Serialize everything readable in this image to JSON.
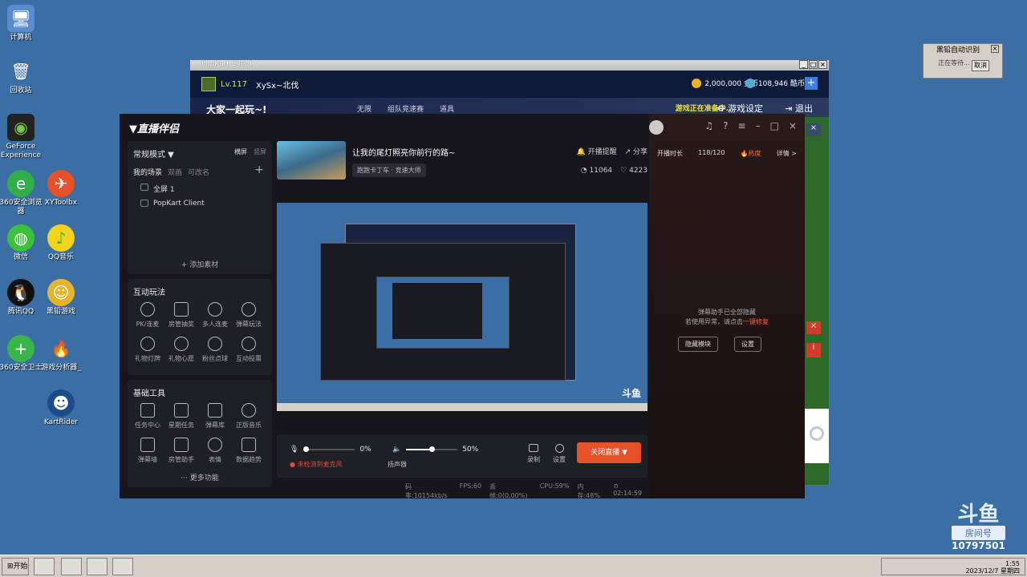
{
  "desktop": {
    "icons": [
      "计算机",
      "回收站",
      "GeForce Experience",
      "360安全浏览器",
      "360安全卫士",
      "微信",
      "QQ音乐",
      "腾讯QQ",
      "黑铅游戏",
      "XYToolbx",
      "游戏分析器_",
      "KartRider"
    ]
  },
  "mini_window": {
    "title": "黑铅自动识别",
    "text": "正在等待...",
    "button": "取消"
  },
  "popkart": {
    "title": "PopKart Client",
    "level": "Lv.117",
    "name": "XySx~北伐",
    "coins": "2,000,000 金币",
    "gems": "108,946 酷币",
    "slogan": "大家一起玩~!",
    "tabs": [
      "无限",
      "组队竞速赛",
      "道具"
    ],
    "status": "游戏正在准备中...",
    "settings": "游戏设定",
    "exit": "退出"
  },
  "live": {
    "app_name": "直播伴侣",
    "mode": "常规模式 ▼",
    "mode_opts": [
      "横屏",
      "竖屏"
    ],
    "scene_tabs": [
      "我的场景",
      "双画",
      "可改名"
    ],
    "scenes": [
      "全屏 1",
      "PopKart Client"
    ],
    "add_source": "+ 添加素材",
    "interact_title": "互动玩法",
    "interact": [
      "PK/连麦",
      "房管抽奖",
      "多人连麦",
      "弹幕玩法",
      "礼物灯牌",
      "礼物心愿",
      "粉丝点球",
      "互动投票"
    ],
    "tools_title": "基础工具",
    "tools": [
      "任务中心",
      "星期任务",
      "弹幕库",
      "正版音乐",
      "弹幕墙",
      "房管助手",
      "表情",
      "数据趋势"
    ],
    "more": "··· 更多功能",
    "room_title": "让我的尾灯照亮你前行的路~",
    "room_tag": "跑跑卡丁车 · 竞速大师",
    "act_remind": "开播提醒",
    "act_share": "分享",
    "fans": "11064",
    "likes": "4223",
    "mic_pct": "0%",
    "mic_warn": "未检测到麦克风",
    "spk_pct": "50%",
    "spk_label": "扬声器",
    "rec_label": "录制",
    "set_label": "设置",
    "close_btn": "关闭直播 ▼",
    "status": [
      "码率:10154kb/s",
      "FPS:60",
      "丢帧:0(0.00%)",
      "CPU:59%",
      "内存:48%",
      "⊙ 02:14:59"
    ],
    "live_time_label": "开播时长",
    "live_time": "118/120",
    "heat": "🔥热度",
    "detail": "详情 >",
    "danmu_line1": "弹幕助手已全部隐藏",
    "danmu_line2": "若使用异常，请点击",
    "danmu_link": "一键修复",
    "danmu_btn1": "隐藏模块",
    "danmu_btn2": "设置",
    "preview_logo": "斗鱼"
  },
  "taskbar": {
    "start": "开始",
    "time": "1:55",
    "date": "2023/12/7 星期四"
  },
  "room_logo": {
    "brand": "斗鱼",
    "label": "房间号",
    "number": "10797501"
  }
}
